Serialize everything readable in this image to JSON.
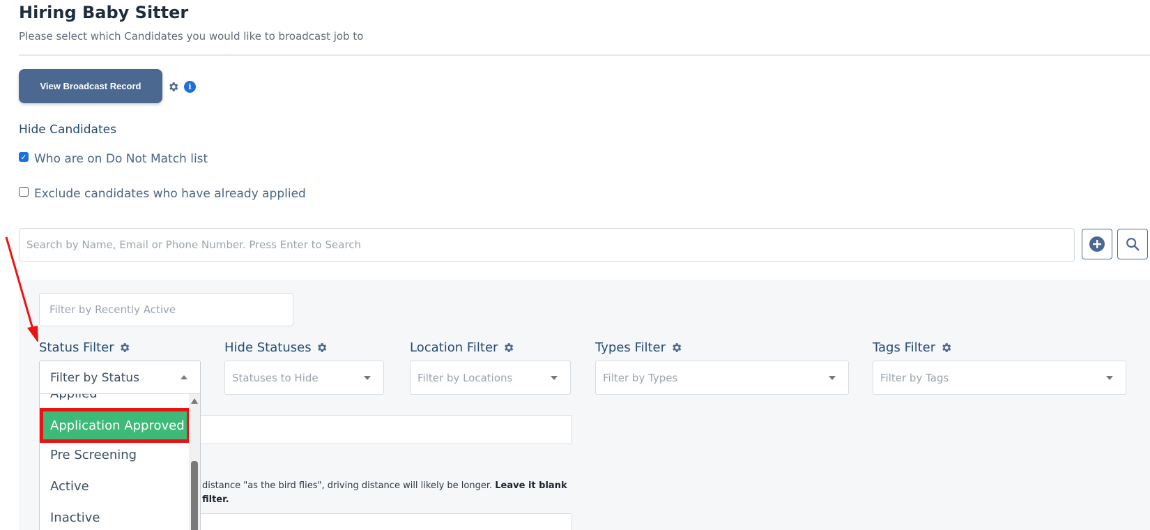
{
  "header": {
    "title": "Hiring Baby Sitter",
    "subtitle": "Please select which Candidates you would like to broadcast job to"
  },
  "toolbar": {
    "broadcast_button": "View Broadcast Record",
    "info_icon": "i"
  },
  "hide_candidates": {
    "title": "Hide Candidates",
    "options": [
      {
        "label": "Who are on Do Not Match list",
        "checked": true
      },
      {
        "label": "Exclude candidates who have already applied",
        "checked": false
      }
    ]
  },
  "search": {
    "placeholder": "Search by Name, Email or Phone Number. Press Enter to Search"
  },
  "filters": {
    "recent_placeholder": "Filter by Recently Active",
    "status": {
      "label": "Status Filter",
      "value": "Filter by Status"
    },
    "hide_statuses": {
      "label": "Hide Statuses",
      "placeholder": "Statuses to Hide"
    },
    "location": {
      "label": "Location Filter",
      "placeholder": "Filter by Locations"
    },
    "types": {
      "label": "Types Filter",
      "placeholder": "Filter by Types"
    },
    "tags": {
      "label": "Tags Filter",
      "placeholder": "Filter by Tags"
    }
  },
  "status_dropdown": {
    "items": [
      "Applied",
      "Application Approved",
      "Pre Screening",
      "Active",
      "Inactive"
    ],
    "highlighted": "Application Approved"
  },
  "distance_note": {
    "text": "distance \"as the bird flies\", driving distance will likely be longer.",
    "bold_1": "Leave it blank",
    "bold_2": "filter."
  },
  "colors": {
    "primary_button": "#4a6890",
    "highlight": "#3dba78",
    "annotation": "#ee1111",
    "checkbox": "#1e6fd9"
  }
}
